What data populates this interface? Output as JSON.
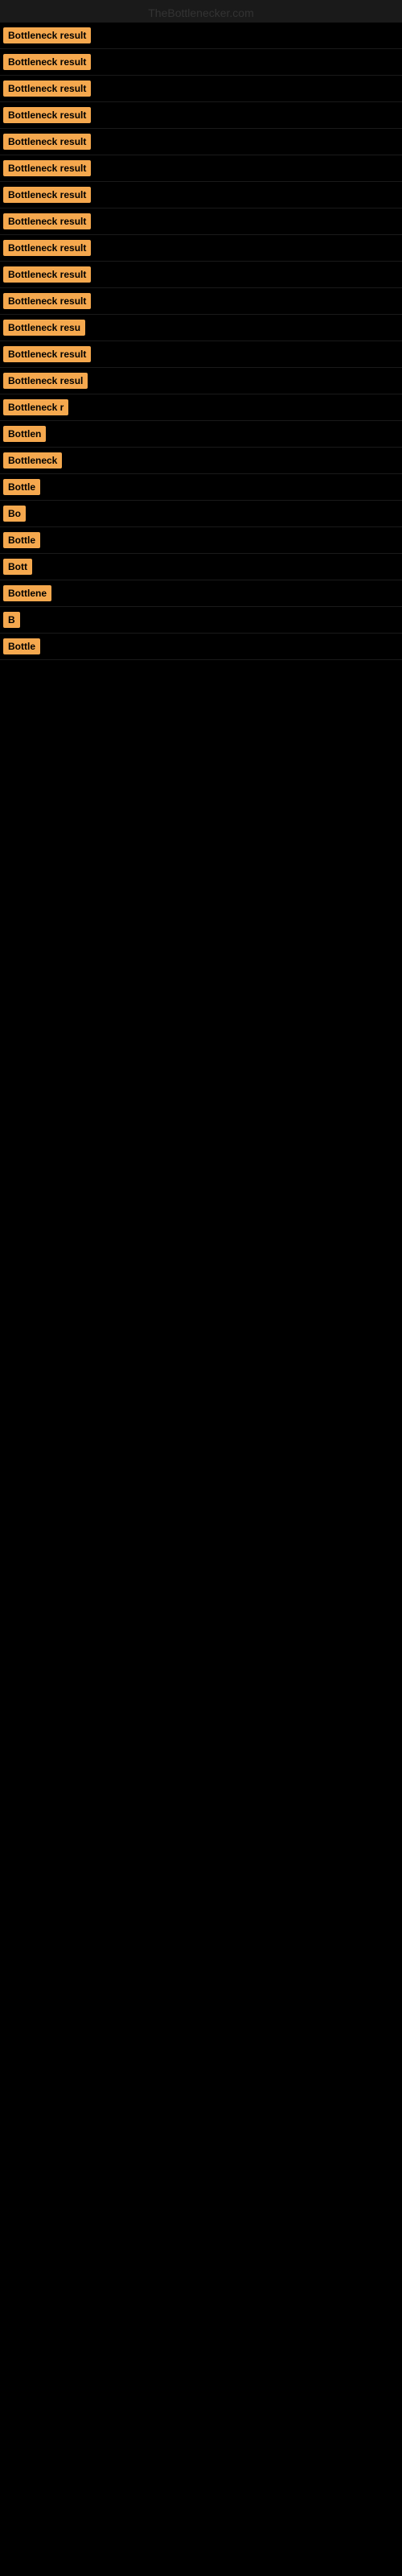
{
  "site": {
    "title": "TheBottlenecker.com"
  },
  "results": [
    {
      "label": "Bottleneck result",
      "visible_text": "Bottleneck result"
    },
    {
      "label": "Bottleneck result",
      "visible_text": "Bottleneck result"
    },
    {
      "label": "Bottleneck result",
      "visible_text": "Bottleneck result"
    },
    {
      "label": "Bottleneck result",
      "visible_text": "Bottleneck result"
    },
    {
      "label": "Bottleneck result",
      "visible_text": "Bottleneck result"
    },
    {
      "label": "Bottleneck result",
      "visible_text": "Bottleneck result"
    },
    {
      "label": "Bottleneck result",
      "visible_text": "Bottleneck result"
    },
    {
      "label": "Bottleneck result",
      "visible_text": "Bottleneck result"
    },
    {
      "label": "Bottleneck result",
      "visible_text": "Bottleneck result"
    },
    {
      "label": "Bottleneck result",
      "visible_text": "Bottleneck result"
    },
    {
      "label": "Bottleneck result",
      "visible_text": "Bottleneck result"
    },
    {
      "label": "Bottleneck resu",
      "visible_text": "Bottleneck resu"
    },
    {
      "label": "Bottleneck result",
      "visible_text": "Bottleneck result"
    },
    {
      "label": "Bottleneck resul",
      "visible_text": "Bottleneck resul"
    },
    {
      "label": "Bottleneck r",
      "visible_text": "Bottleneck r"
    },
    {
      "label": "Bottlen",
      "visible_text": "Bottlen"
    },
    {
      "label": "Bottleneck",
      "visible_text": "Bottleneck"
    },
    {
      "label": "Bottle",
      "visible_text": "Bottle"
    },
    {
      "label": "Bo",
      "visible_text": "Bo"
    },
    {
      "label": "Bottle",
      "visible_text": "Bottle"
    },
    {
      "label": "Bott",
      "visible_text": "Bott"
    },
    {
      "label": "Bottlene",
      "visible_text": "Bottlene"
    },
    {
      "label": "B",
      "visible_text": "B"
    },
    {
      "label": "Bottle",
      "visible_text": "Bottle"
    }
  ]
}
